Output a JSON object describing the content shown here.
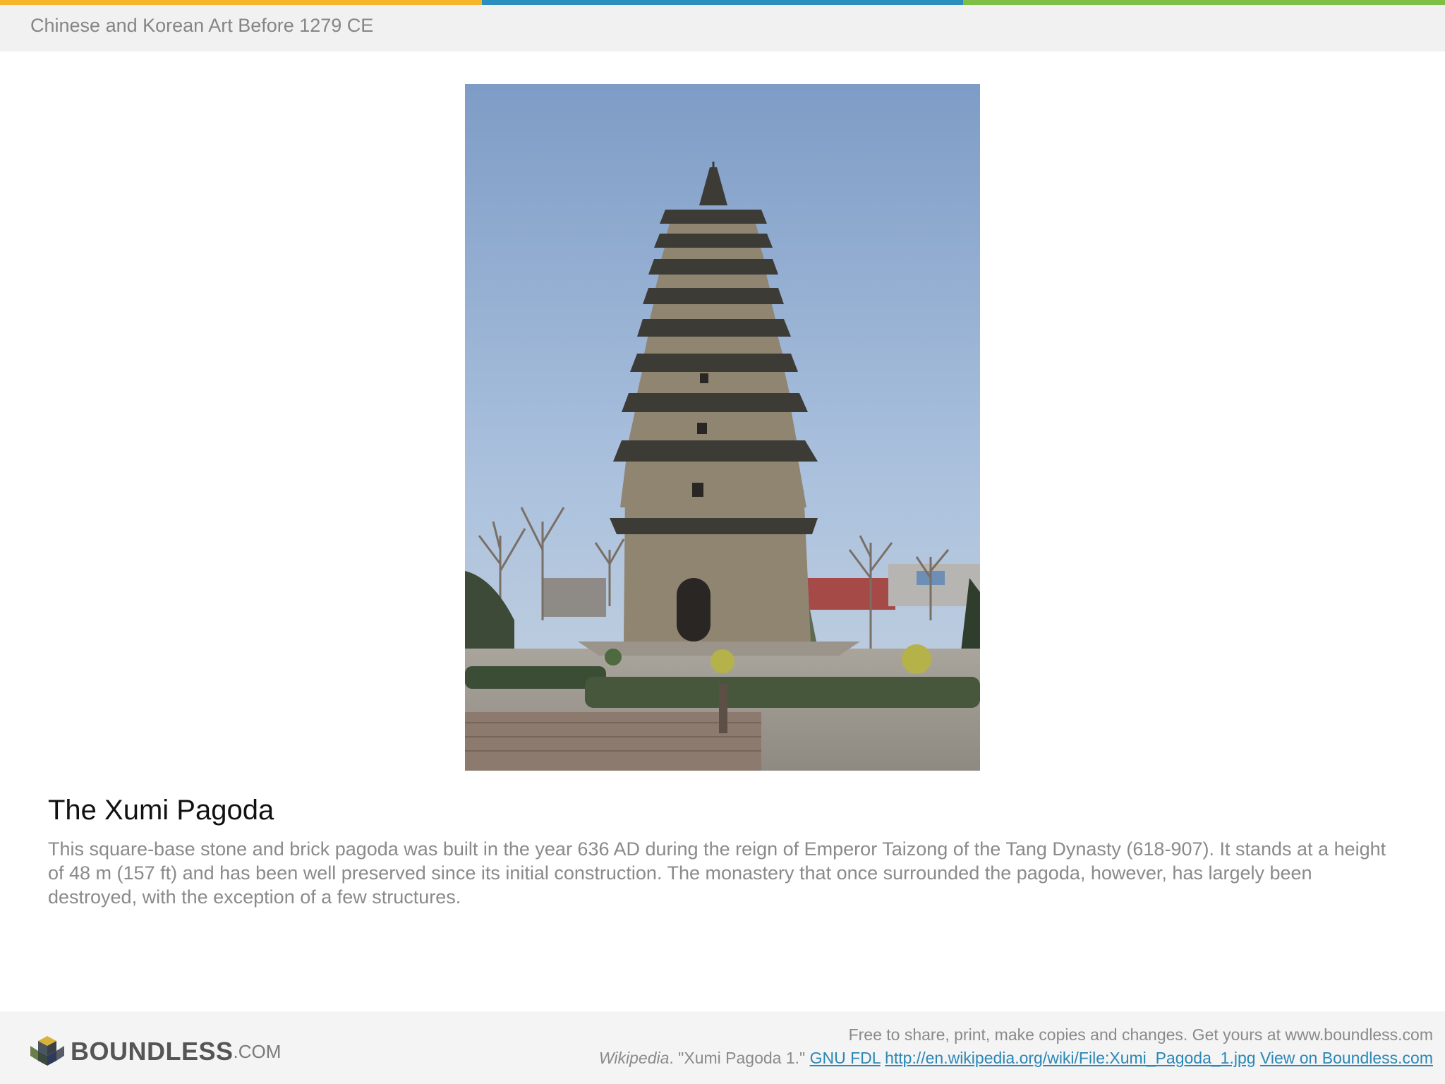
{
  "colors": {
    "bar_orange": "#f7b52c",
    "bar_blue": "#2a8fbd",
    "bar_green": "#7fbf45",
    "link": "#2a87b6"
  },
  "header": {
    "title": "Chinese and Korean Art Before 1279 CE"
  },
  "figure": {
    "icon": "pagoda-photo"
  },
  "caption": {
    "title": "The Xumi Pagoda",
    "text": "This square-base stone and brick pagoda was built in the year 636 AD during the reign of Emperor Taizong of the Tang Dynasty (618-907). It stands at a height of 48 m (157 ft) and has been well preserved since its initial construction. The monastery that once surrounded the pagoda, however, has largely been destroyed, with the exception of a few structures."
  },
  "footer": {
    "logo_word": "BOUNDLESS",
    "logo_suffix": ".COM",
    "share_text": "Free to share, print, make copies and changes. Get yours at www.boundless.com",
    "source_name": "Wikipedia",
    "source_sep": ".",
    "source_title": " \"Xumi Pagoda 1.\" ",
    "license_label": "GNU FDL",
    "source_url": "http://en.wikipedia.org/wiki/File:Xumi_Pagoda_1.jpg",
    "view_label": "View on Boundless.com"
  }
}
